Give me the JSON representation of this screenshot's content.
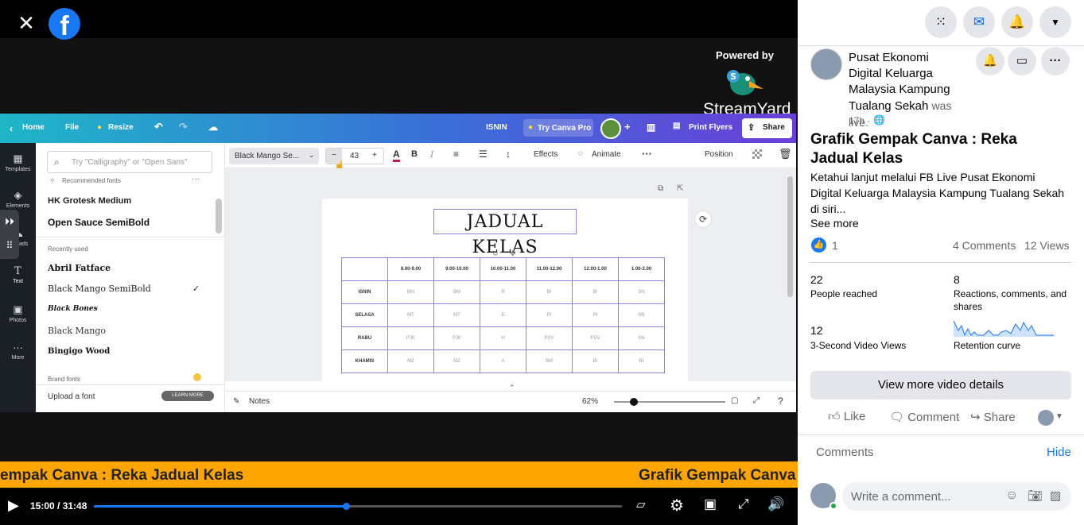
{
  "player": {
    "close_icon": "close-icon",
    "logo_icon": "facebook-logo",
    "logo_letter": "f",
    "streamyard_powered": "Powered by",
    "streamyard_name": "StreamYard",
    "ticker_text_1": "empak Canva : Reka Jadual Kelas",
    "ticker_text_2": "Grafik Gempak Canva",
    "time": "15:00 / 31:48",
    "progress_fraction": 0.477,
    "colors": {
      "accent": "#1877f2",
      "ticker": "#ffa500"
    }
  },
  "canva": {
    "top_bar": {
      "home": "Home",
      "file": "File",
      "resize": "Resize",
      "page_name": "ISNIN",
      "try_pro": "Try Canva Pro",
      "print": "Print Flyers",
      "share": "Share"
    },
    "rail": [
      "Templates",
      "Elements",
      "Uploads",
      "Text",
      "Photos",
      "More"
    ],
    "font_panel": {
      "search_placeholder": "Try \"Calligraphy\" or \"Open Sans\"",
      "recommended": "Recommended fonts",
      "rec_fonts": [
        "HK Grotesk Medium",
        "Open Sauce SemiBold"
      ],
      "recently_used": "Recently used",
      "recent_fonts": [
        "Abril Fatface",
        "Black Mango SemiBold",
        "Black Bones",
        "Black Mango",
        "Bingigo Wood"
      ],
      "brand_fonts": "Brand fonts",
      "upload": "Upload a font",
      "learn_more": "LEARN MORE"
    },
    "toolbar": {
      "font": "Black Mango Se...",
      "size": "43",
      "effects": "Effects",
      "animate": "Animate",
      "position": "Position"
    },
    "page": {
      "title": "JADUAL KELAS",
      "headers": [
        "",
        "8.00-9.00",
        "9.00-10.00",
        "10.00-11.00",
        "11.00-12.00",
        "12.00-1.00",
        "1.00-2.00"
      ],
      "rows": [
        [
          "ISNIN",
          "BM",
          "BM",
          "R",
          "BI",
          "BI",
          "SN"
        ],
        [
          "SELASA",
          "MT",
          "MT",
          "E",
          "PI",
          "PI",
          "SN"
        ],
        [
          "RABU",
          "PJK",
          "PJK",
          "H",
          "PSV",
          "PSV",
          "SN"
        ],
        [
          "KHAMIS",
          "MZ",
          "MZ",
          "A",
          "BM",
          "BI",
          "BI"
        ]
      ]
    },
    "bottom": {
      "notes": "Notes",
      "zoom": "62%",
      "zoom_fraction": 0.18
    }
  },
  "side": {
    "top_icons": [
      "apps-grid-icon",
      "messenger-icon",
      "bell-icon",
      "caret-down-icon"
    ],
    "page_name": "Pusat Ekonomi Digital Keluarga Malaysia Kampung Tualang Sekah",
    "live_text": "was live.",
    "time_ago": "17h ·",
    "title": "Grafik Gempak Canva : Reka Jadual Kelas",
    "description": "Ketahui lanjut melalui FB Live Pusat Ekonomi Digital Keluarga Malaysia Kampung Tualang Sekah di siri...",
    "see_more": "See more",
    "like_count": "1",
    "comments_count": "4 Comments",
    "views_count": "12 Views",
    "stats": [
      {
        "value": "22",
        "label": "People reached"
      },
      {
        "value": "8",
        "label": "Reactions, comments, and shares"
      },
      {
        "value": "12",
        "label": "3-Second Video Views"
      },
      {
        "value": "",
        "label": "Retention curve"
      }
    ],
    "view_more": "View more video details",
    "like": "Like",
    "comment": "Comment",
    "share": "Share",
    "comments_label": "Comments",
    "hide": "Hide",
    "comment_placeholder": "Write a comment..."
  }
}
